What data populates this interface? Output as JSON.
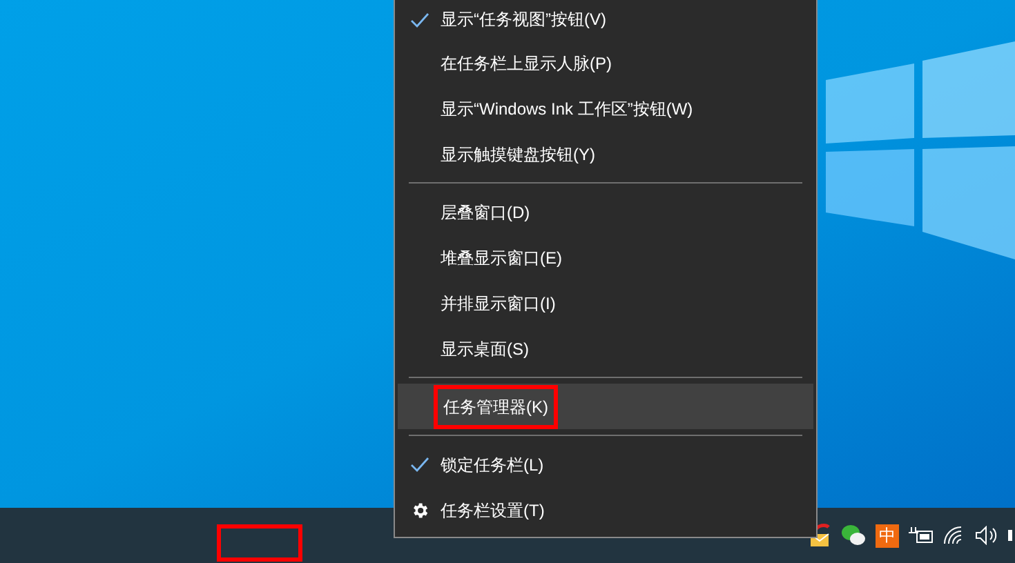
{
  "context_menu": {
    "items": [
      {
        "kind": "item",
        "label": "显示“任务视图”按钮(V)",
        "checked": true,
        "selected": false,
        "marked": false
      },
      {
        "kind": "item",
        "label": "在任务栏上显示人脉(P)",
        "checked": false,
        "selected": false,
        "marked": false
      },
      {
        "kind": "item",
        "label": "显示“Windows Ink 工作区”按钮(W)",
        "checked": false,
        "selected": false,
        "marked": false
      },
      {
        "kind": "item",
        "label": "显示触摸键盘按钮(Y)",
        "checked": false,
        "selected": false,
        "marked": false
      },
      {
        "kind": "separator"
      },
      {
        "kind": "item",
        "label": "层叠窗口(D)",
        "checked": false,
        "selected": false,
        "marked": false
      },
      {
        "kind": "item",
        "label": "堆叠显示窗口(E)",
        "checked": false,
        "selected": false,
        "marked": false
      },
      {
        "kind": "item",
        "label": "并排显示窗口(I)",
        "checked": false,
        "selected": false,
        "marked": false
      },
      {
        "kind": "item",
        "label": "显示桌面(S)",
        "checked": false,
        "selected": false,
        "marked": false
      },
      {
        "kind": "separator"
      },
      {
        "kind": "item",
        "label": "任务管理器(K)",
        "checked": false,
        "selected": true,
        "marked": true
      },
      {
        "kind": "separator"
      },
      {
        "kind": "item",
        "label": "锁定任务栏(L)",
        "checked": true,
        "selected": false,
        "marked": false
      },
      {
        "kind": "settings",
        "label": "任务栏设置(T)",
        "selected": false,
        "marked": false
      }
    ]
  },
  "taskbar": {
    "marked_area": true,
    "input_method": "中"
  }
}
